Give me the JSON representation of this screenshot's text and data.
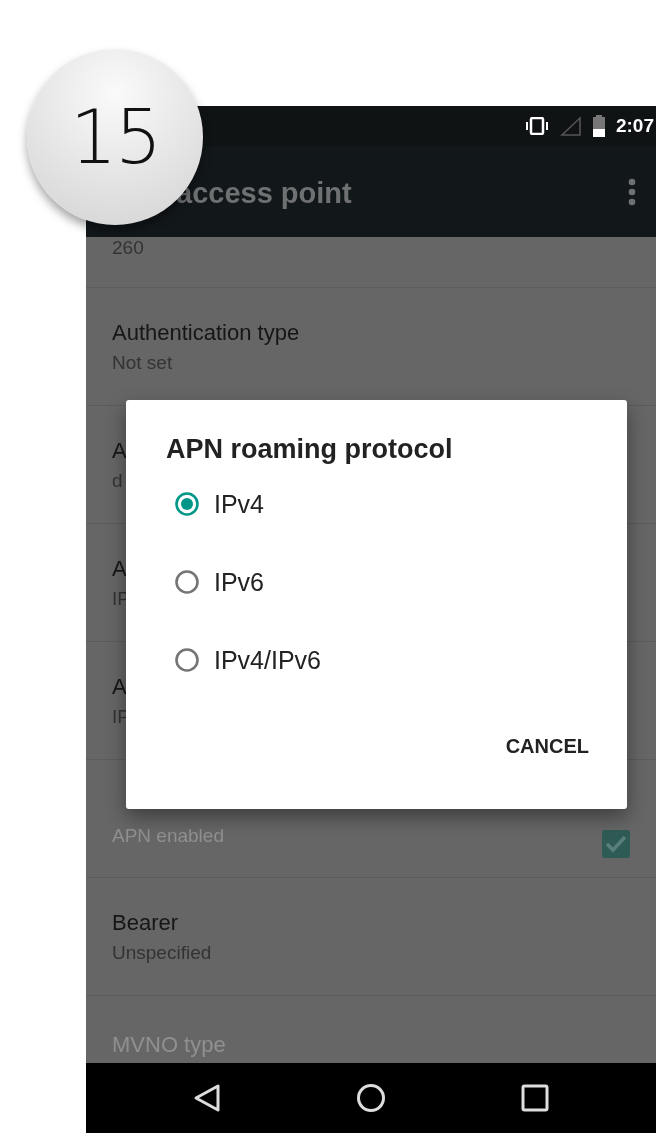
{
  "step_badge": "15",
  "status_bar": {
    "time": "2:07"
  },
  "toolbar": {
    "title": "access point"
  },
  "settings": [
    {
      "kind": "text",
      "summary": "260",
      "disabled": false
    },
    {
      "kind": "text",
      "title": "Authentication type",
      "summary": "Not set",
      "disabled": false
    },
    {
      "kind": "text",
      "title": "A",
      "summary": "d",
      "disabled": false
    },
    {
      "kind": "text",
      "title": "A",
      "summary": "IP",
      "disabled": false
    },
    {
      "kind": "text",
      "title": "A",
      "summary": "IP",
      "disabled": false
    },
    {
      "kind": "checkbox",
      "summary": "APN enabled",
      "disabled": true,
      "checked": true
    },
    {
      "kind": "text",
      "title": "Bearer",
      "summary": "Unspecified",
      "disabled": false
    },
    {
      "kind": "text",
      "title": "MVNO type",
      "disabled": true
    }
  ],
  "dialog": {
    "title": "APN roaming protocol",
    "options": [
      {
        "label": "IPv4",
        "selected": true
      },
      {
        "label": "IPv6",
        "selected": false
      },
      {
        "label": "IPv4/IPv6",
        "selected": false
      }
    ],
    "buttons": [
      "CANCEL"
    ]
  }
}
